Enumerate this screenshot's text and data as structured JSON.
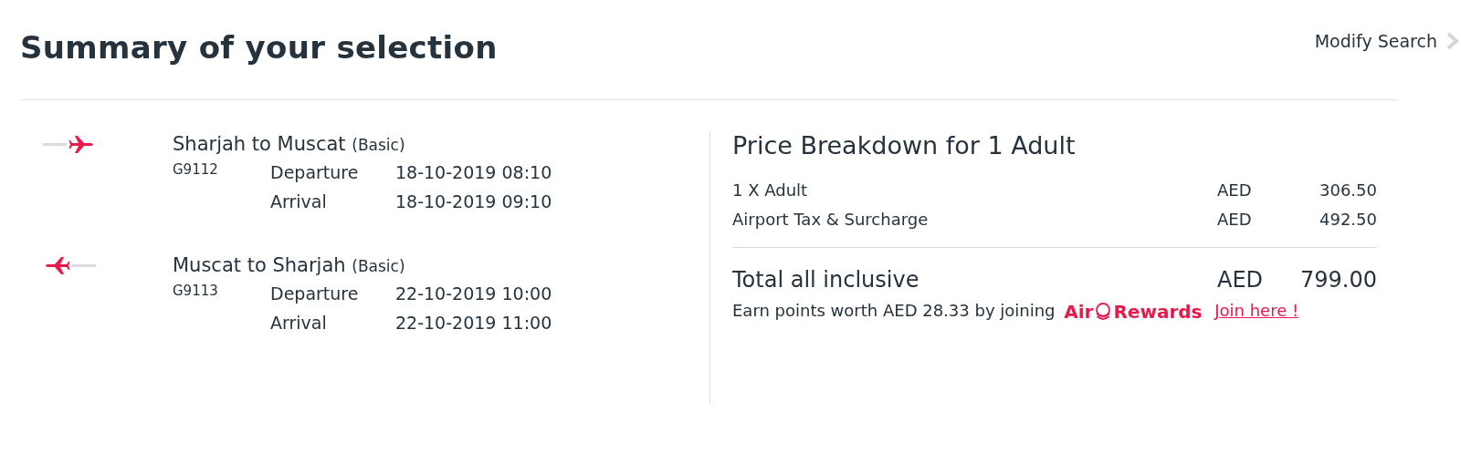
{
  "header": {
    "title": "Summary of your selection",
    "modify_link": "Modify Search"
  },
  "flights": [
    {
      "kind": "outbound",
      "route": "Sharjah to Muscat",
      "fare": "(Basic)",
      "flight_number": "G9112",
      "times": [
        {
          "label": "Departure",
          "value": "18-10-2019 08:10"
        },
        {
          "label": "Arrival",
          "value": "18-10-2019 09:10"
        }
      ]
    },
    {
      "kind": "return",
      "route": "Muscat to Sharjah",
      "fare": "(Basic)",
      "flight_number": "G9113",
      "times": [
        {
          "label": "Departure",
          "value": "22-10-2019 10:00"
        },
        {
          "label": "Arrival",
          "value": "22-10-2019 11:00"
        }
      ]
    }
  ],
  "price": {
    "title": "Price Breakdown for 1 Adult",
    "items": [
      {
        "label": "1 X Adult",
        "currency": "AED",
        "amount": "306.50"
      },
      {
        "label": "Airport Tax & Surcharge",
        "currency": "AED",
        "amount": "492.50"
      }
    ],
    "total": {
      "label": "Total all inclusive",
      "currency": "AED",
      "amount": "799.00"
    },
    "rewards": {
      "text": "Earn points worth AED 28.33 by joining",
      "logo_left": "Air",
      "logo_right": "Rewards",
      "link": "Join here !"
    }
  }
}
